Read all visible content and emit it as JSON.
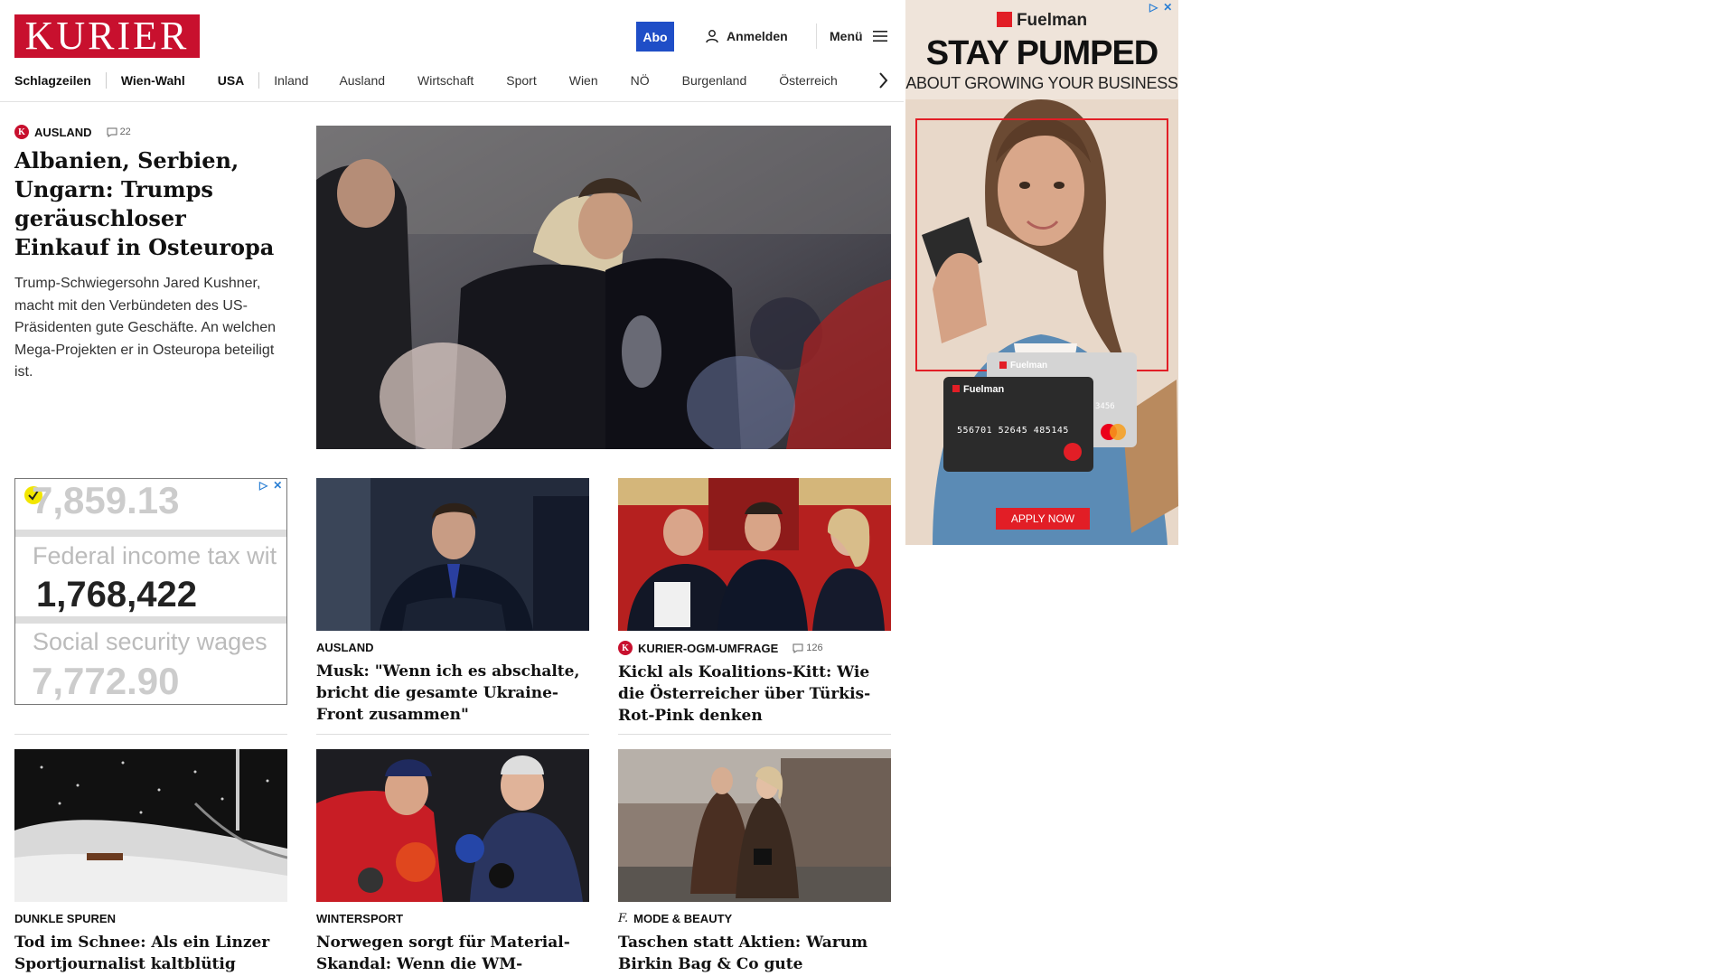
{
  "header": {
    "logo": "KURIER",
    "abo": "Abo",
    "login": "Anmelden",
    "menu": "Menü"
  },
  "nav": {
    "items": [
      "Schlagzeilen",
      "Wien-Wahl",
      "USA",
      "Inland",
      "Ausland",
      "Wirtschaft",
      "Sport",
      "Wien",
      "NÖ",
      "Burgenland",
      "Österreich"
    ]
  },
  "lead": {
    "kicker": "AUSLAND",
    "comments": "22",
    "headline": "Albanien, Serbien, Ungarn: Trumps geräuschloser Einkauf in Osteuropa",
    "teaser": "Trump-Schwiegersohn Jared Kushner, macht mit den Verbündeten des US-Präsidenten gute Geschäfte. An welchen Mega-Projekten er in Osteuropa beteiligt ist."
  },
  "cards": [
    {
      "kicker": "AUSLAND",
      "headline": "Musk: \"Wenn ich es abschalte, bricht die gesamte Ukraine-Front zusammen\""
    },
    {
      "kicker": "KURIER-OGM-UMFRAGE",
      "comments": "126",
      "headline": "Kickl als Koalitions-Kitt: Wie die Österreicher über Türkis-Rot-Pink denken"
    },
    {
      "kicker": "DUNKLE SPUREN",
      "headline": "Tod im Schnee: Als ein Linzer Sportjournalist kaltblütig ermordet wurde"
    },
    {
      "kicker": "WINTERSPORT",
      "headline": "Norwegen sorgt für Material-Skandal: Wenn die WM-Gastgeber betrügen"
    },
    {
      "kicker": "MODE & BEAUTY",
      "headline": "Taschen statt Aktien: Warum Birkin Bag & Co gute Wertanlagen sind"
    }
  ],
  "ad_small": {
    "top_number": "7,859.13",
    "label1": "Federal income tax wit",
    "value": "1,768,422",
    "label2": "Social security wages",
    "bottom_number": "7,772.90"
  },
  "ad_right": {
    "brand": "Fuelman",
    "headline": "STAY PUMPED",
    "subline": "ABOUT GROWING YOUR BUSINESS",
    "card_brand": "Fuelman",
    "card_number": "556701 52645 485145",
    "card_digits": "3456",
    "apply": "APPLY NOW"
  },
  "colors": {
    "brand_red": "#c8102e",
    "abo_blue": "#1f4ec7",
    "ad_red": "#e21e26"
  }
}
